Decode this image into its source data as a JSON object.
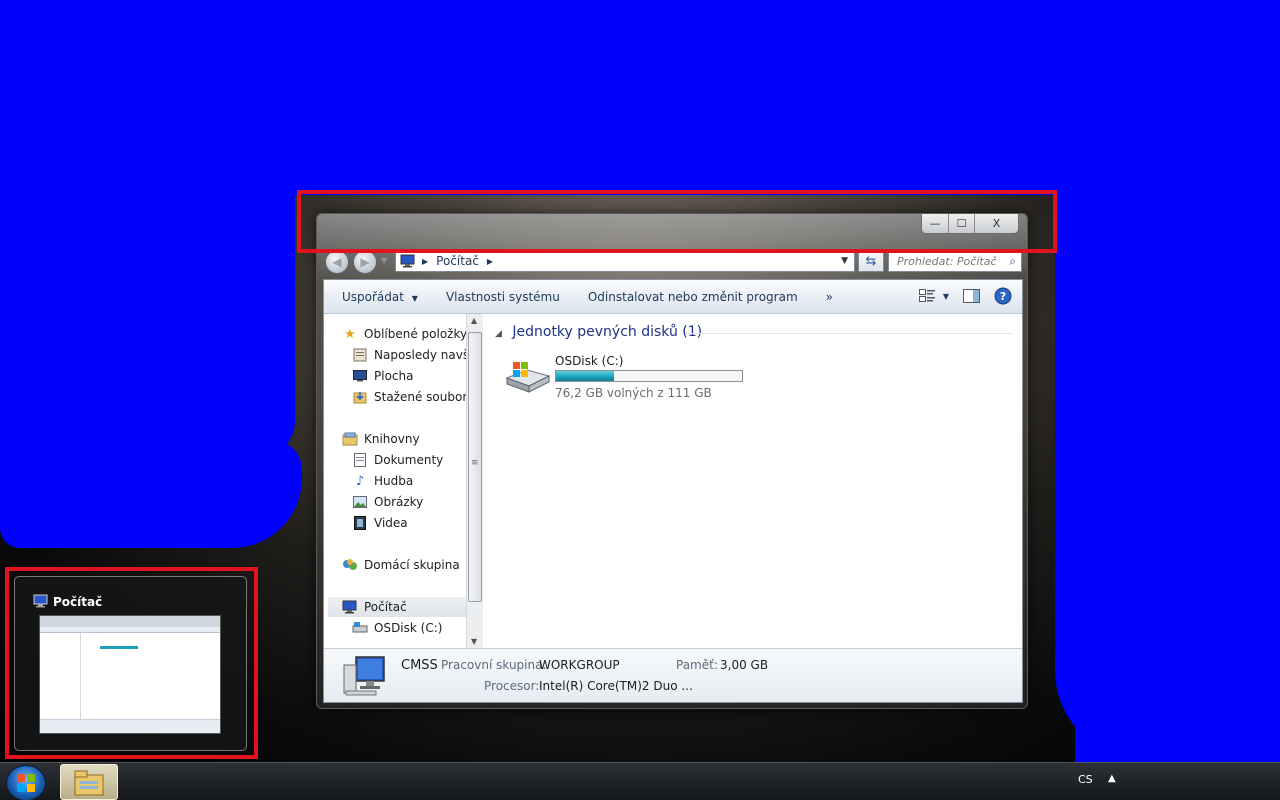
{
  "window": {
    "title_buttons": {
      "minimize": "—",
      "maximize": "☐",
      "close": "X"
    },
    "address": {
      "crumb": "Počítač"
    },
    "search": {
      "placeholder": "Prohledat: Počítač"
    },
    "toolbar": {
      "organize": "Uspořádat",
      "system_properties": "Vlastnosti systému",
      "uninstall": "Odinstalovat nebo změnit program",
      "more": "»"
    },
    "nav": {
      "favorites": "Oblíbené položky",
      "recent": "Naposledy navštívené",
      "desktop": "Plocha",
      "downloads": "Stažené soubory",
      "libraries": "Knihovny",
      "documents": "Dokumenty",
      "music": "Hudba",
      "pictures": "Obrázky",
      "videos": "Videa",
      "homegroup": "Domácí skupina",
      "computer": "Počítač",
      "osdisk": "OSDisk (C:)"
    },
    "content": {
      "group_header": "Jednotky pevných disků (1)",
      "drive": {
        "name": "OSDisk (C:)",
        "free_text": "76,2 GB volných z 111 GB",
        "used_fraction": 0.31
      }
    },
    "details": {
      "computer_name": "CMSS",
      "workgroup_label": "Pracovní skupina:",
      "workgroup_value": "WORKGROUP",
      "memory_label": "Paměť:",
      "memory_value": "3,00 GB",
      "cpu_label": "Procesor:",
      "cpu_value": "Intel(R) Core(TM)2 Duo ..."
    }
  },
  "preview": {
    "title": "Počítač"
  },
  "taskbar": {
    "language": "CS",
    "tray_arrow": "▲"
  },
  "colors": {
    "desktop_blue": "#0000ff",
    "highlight_red": "#e0141e"
  }
}
